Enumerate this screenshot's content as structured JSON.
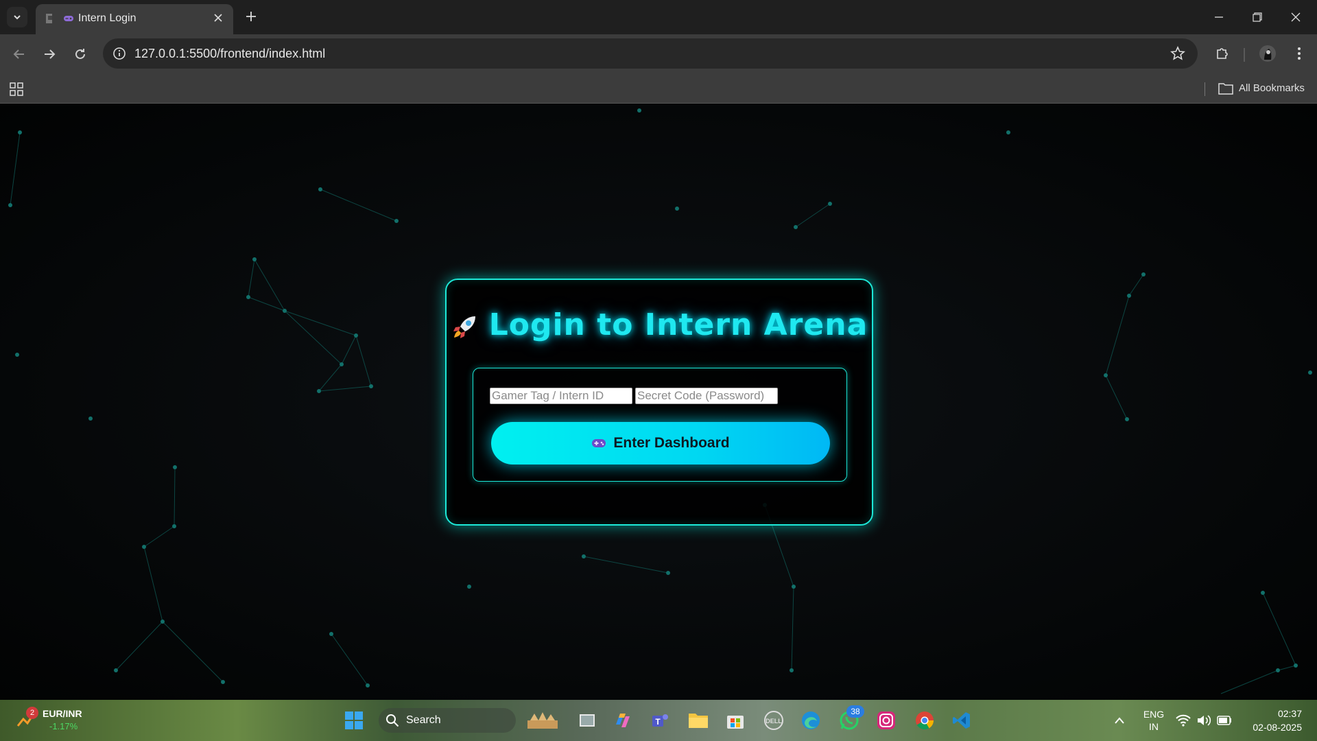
{
  "browser": {
    "tab_title": "Intern Login",
    "url": "127.0.0.1:5500/frontend/index.html",
    "bookmarks_label": "All Bookmarks"
  },
  "login": {
    "title": "Login to Intern Arena",
    "title_emoji": "rocket",
    "username_placeholder": "Gamer Tag / Intern ID",
    "password_placeholder": "Secret Code (Password)",
    "submit_label": "Enter Dashboard",
    "submit_emoji": "game-controller"
  },
  "taskbar": {
    "weather_badge": "2",
    "ticker_name": "EUR/INR",
    "ticker_change": "-1.17%",
    "search_label": "Search",
    "whatsapp_badge": "38",
    "lang_primary": "ENG",
    "lang_secondary": "IN",
    "time": "02:37",
    "date": "02-08-2025"
  },
  "colors": {
    "accent": "#1de9d8",
    "title": "#1fe8f0",
    "button": "#00e0f2",
    "page_bg": "#050708"
  }
}
